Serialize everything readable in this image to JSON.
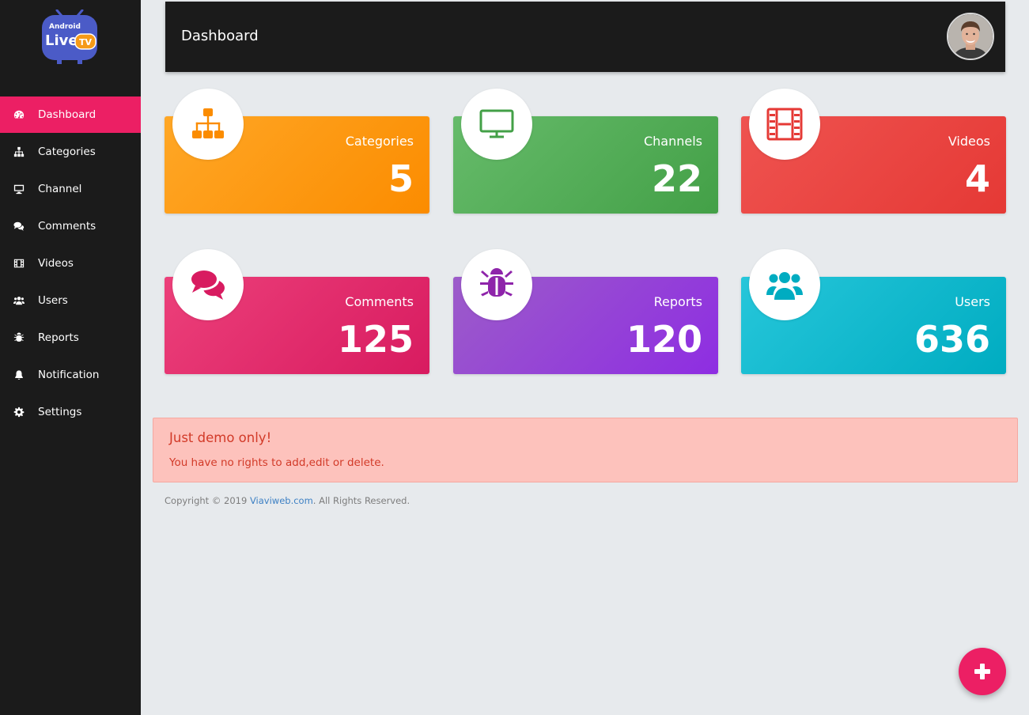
{
  "app": {
    "logo": {
      "line1": "Android",
      "line2": "Live",
      "badge": "TV",
      "icon": "tv-logo-icon"
    }
  },
  "header": {
    "title": "Dashboard",
    "avatar_icon": "user-avatar"
  },
  "sidebar": {
    "items": [
      {
        "label": "Dashboard",
        "icon": "dashboard-icon",
        "active": true
      },
      {
        "label": "Categories",
        "icon": "sitemap-icon"
      },
      {
        "label": "Channel",
        "icon": "monitor-icon"
      },
      {
        "label": "Comments",
        "icon": "comments-icon"
      },
      {
        "label": "Videos",
        "icon": "film-icon"
      },
      {
        "label": "Users",
        "icon": "users-icon"
      },
      {
        "label": "Reports",
        "icon": "bug-icon"
      },
      {
        "label": "Notification",
        "icon": "bell-icon"
      },
      {
        "label": "Settings",
        "icon": "gear-icon"
      }
    ]
  },
  "cards": [
    {
      "label": "Categories",
      "value": "5",
      "icon": "sitemap-icon",
      "color": "#ff9800"
    },
    {
      "label": "Channels",
      "value": "22",
      "icon": "monitor-icon",
      "color": "#4caf50"
    },
    {
      "label": "Videos",
      "value": "4",
      "icon": "film-icon",
      "color": "#e53935"
    },
    {
      "label": "Comments",
      "value": "125",
      "icon": "comments-icon",
      "color": "#e91e63"
    },
    {
      "label": "Reports",
      "value": "120",
      "icon": "bug-icon",
      "color": "#9c27b0"
    },
    {
      "label": "Users",
      "value": "636",
      "icon": "users-icon",
      "color": "#00bcd4"
    }
  ],
  "alert": {
    "title": "Just demo only!",
    "text": "You have no rights to add,edit or delete."
  },
  "footer": {
    "prefix": "Copyright © 2019 ",
    "link": "Viaviweb.com",
    "suffix": ". All Rights Reserved."
  },
  "fab": {
    "icon": "plus-icon"
  }
}
